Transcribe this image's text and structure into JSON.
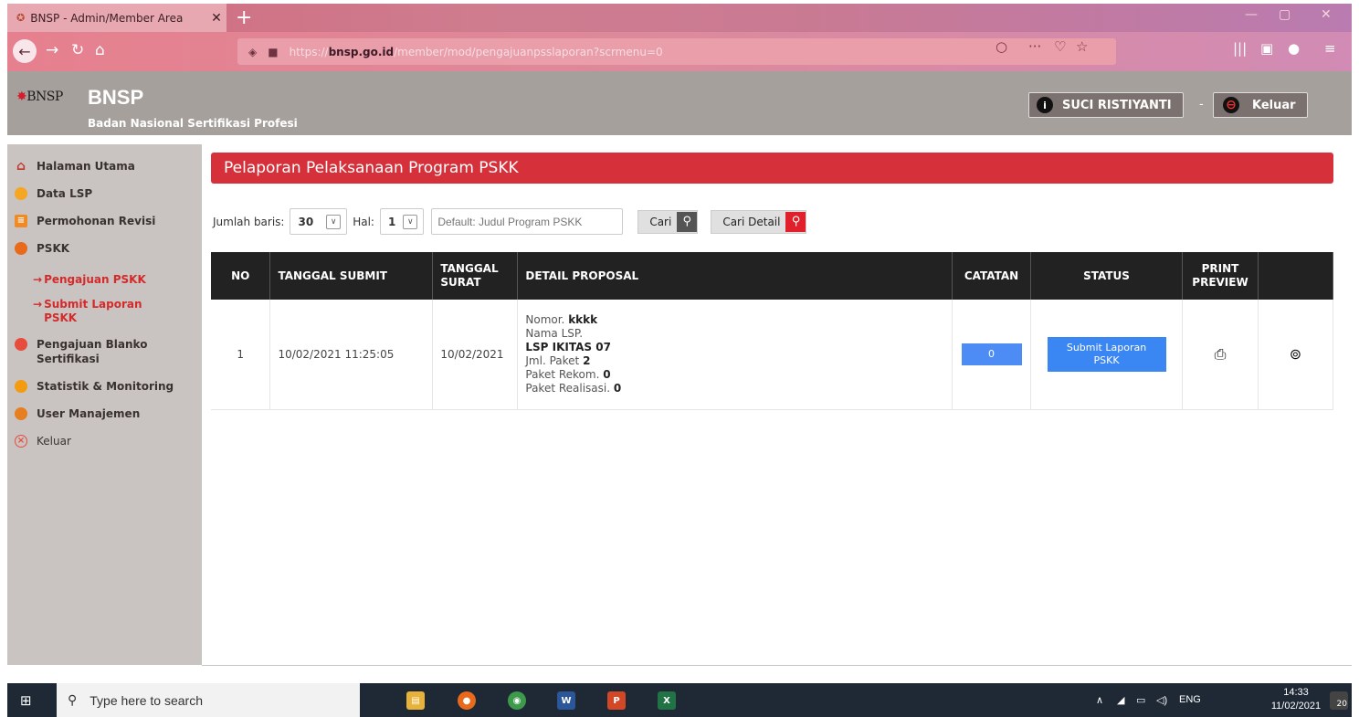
{
  "browser": {
    "tab_title": "BNSP - Admin/Member Area",
    "tab_close": "✕",
    "new_tab": "+",
    "url_prefix": "https://",
    "url_host": "bnsp.go.id",
    "url_path": "/member/mod/pengajuanpsslaporan?scrmenu=0"
  },
  "header": {
    "logo_text": "BNSP",
    "title": "BNSP",
    "subtitle": "Badan Nasional Sertifikasi Profesi",
    "user_name": "SUCI RISTIYANTI",
    "separator": "-",
    "logout_label": "Keluar"
  },
  "sidebar": {
    "items": [
      {
        "label": "Halaman Utama",
        "color": "#c0392b"
      },
      {
        "label": "Data LSP",
        "color": "#f5a623"
      },
      {
        "label": "Permohonan Revisi",
        "color": "#f08a24"
      },
      {
        "label": "PSKK",
        "color": "#e86a1a"
      },
      {
        "label": "Pengajuan Blanko Sertifikasi",
        "color": "#e74c3c"
      },
      {
        "label": "Statistik & Monitoring",
        "color": "#f39c12"
      },
      {
        "label": "User Manajemen",
        "color": "#e67e22"
      },
      {
        "label": "Keluar",
        "color": "#e74c3c"
      }
    ],
    "sub_items": [
      {
        "label": "Pengajuan PSKK"
      },
      {
        "label": "Submit Laporan PSKK"
      }
    ]
  },
  "main": {
    "page_title": "Pelaporan Pelaksanaan Program PSKK",
    "filters": {
      "rows_label": "Jumlah baris:",
      "rows_value": "30",
      "page_label": "Hal:",
      "page_value": "1",
      "search_placeholder": "Default: Judul Program PSKK",
      "search_button": "Cari",
      "detail_button": "Cari Detail"
    },
    "table": {
      "headers": [
        "NO",
        "TANGGAL SUBMIT",
        "TANGGAL SURAT",
        "DETAIL PROPOSAL",
        "CATATAN",
        "STATUS",
        "PRINT PREVIEW",
        ""
      ],
      "rows": [
        {
          "no": "1",
          "tanggal_submit": "10/02/2021 11:25:05",
          "tanggal_surat": "10/02/2021",
          "nomor_label": "Nomor.",
          "nomor_value": "kkkk",
          "nama_lsp_label": "Nama LSP.",
          "nama_lsp_value": "LSP IKITAS 07",
          "jml_paket_label": "Jml. Paket",
          "jml_paket_value": "2",
          "paket_rekom_label": "Paket Rekom.",
          "paket_rekom_value": "0",
          "paket_realisasi_label": "Paket Realisasi.",
          "paket_realisasi_value": "0",
          "catatan": "0",
          "status": "Submit Laporan PSKK"
        }
      ]
    }
  },
  "taskbar": {
    "search_placeholder": "Type here to search",
    "language": "ENG",
    "time": "14:33",
    "date": "11/02/2021",
    "notifications": "20"
  }
}
